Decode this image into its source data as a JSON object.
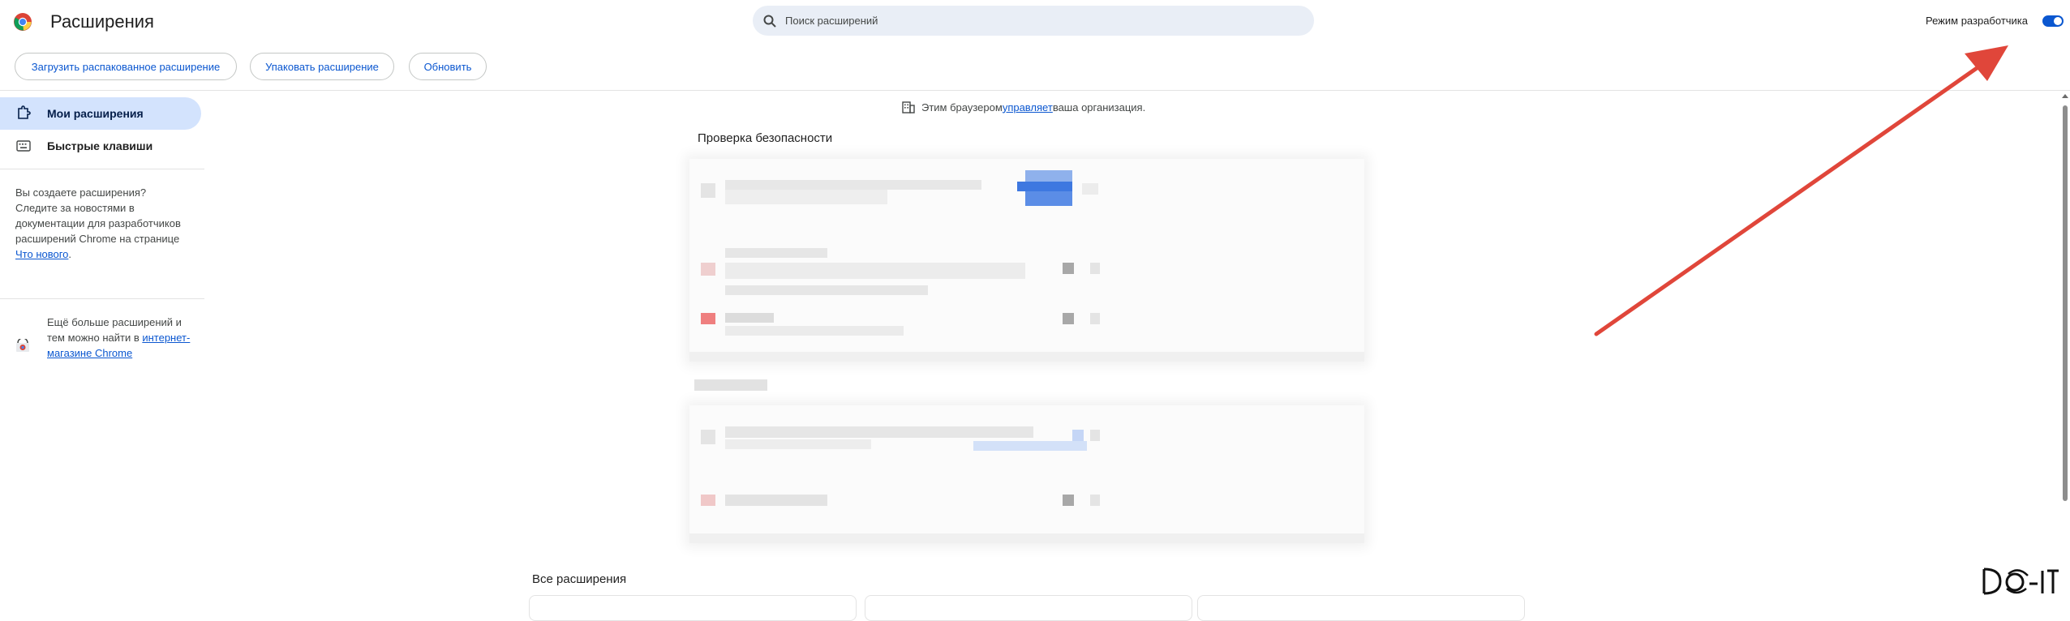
{
  "header": {
    "title": "Расширения",
    "search_placeholder": "Поиск расширений",
    "dev_mode_label": "Режим разработчика",
    "dev_mode_on": true
  },
  "toolbar": {
    "load_unpacked": "Загрузить распакованное расширение",
    "pack": "Упаковать расширение",
    "update": "Обновить"
  },
  "sidebar": {
    "items": [
      {
        "label": "Мои расширения",
        "icon": "extension-puzzle-icon",
        "selected": true
      },
      {
        "label": "Быстрые клавиши",
        "icon": "keyboard-icon",
        "selected": false
      }
    ],
    "dev_promo": {
      "text_before": "Вы создаете расширения? Следите за новостями в документации для разработчиков расширений Chrome на странице ",
      "link": "Что нового",
      "text_after": "."
    },
    "store_promo": {
      "text_before": "Ещё больше расширений и тем можно найти в ",
      "link": "интернет-магазине Chrome"
    }
  },
  "main": {
    "managed": {
      "before": "Этим браузером ",
      "link": "управляет",
      "after": " ваша организация."
    },
    "safety_heading": "Проверка безопасности",
    "all_extensions_heading": "Все расширения"
  },
  "colors": {
    "accent": "#0b57d0",
    "selected_nav": "#d3e3fd",
    "arrow": "#e0463a",
    "search_bg": "#e9eef6"
  }
}
